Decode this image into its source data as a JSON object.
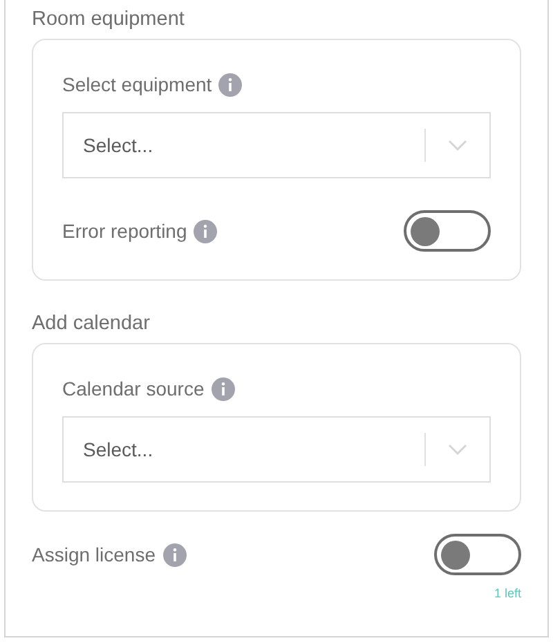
{
  "sections": [
    {
      "title": "Room equipment",
      "fields": [
        {
          "kind": "select",
          "label": "Select equipment",
          "placeholder": "Select..."
        },
        {
          "kind": "toggle",
          "label": "Error reporting",
          "on": false
        }
      ]
    },
    {
      "title": "Add calendar",
      "fields": [
        {
          "kind": "select",
          "label": "Calendar source",
          "placeholder": "Select..."
        }
      ]
    }
  ],
  "license": {
    "label": "Assign license",
    "on": false,
    "remaining": "1 left"
  }
}
